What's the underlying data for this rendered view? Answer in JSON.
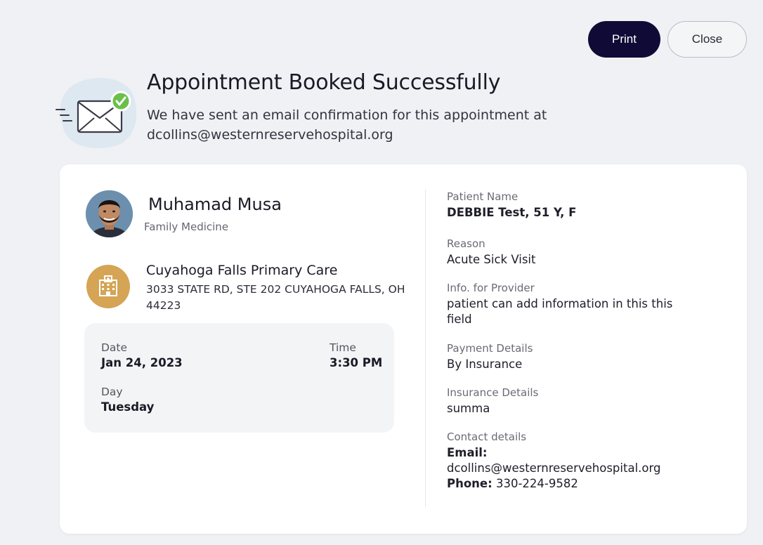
{
  "actions": {
    "print_label": "Print",
    "close_label": "Close"
  },
  "confirmation": {
    "title": "Appointment Booked Successfully",
    "message": "We have sent an email confirmation for this appointment at dcollins@westernreservehospital.org",
    "icon": "email-sent-check-icon"
  },
  "provider": {
    "name": "Muhamad Musa",
    "specialty": "Family Medicine"
  },
  "facility": {
    "name": "Cuyahoga Falls Primary Care",
    "address": "3033 STATE RD, STE 202 CUYAHOGA FALLS, OH 44223",
    "icon": "hospital-building-icon"
  },
  "schedule": {
    "date_label": "Date",
    "date_value": "Jan 24, 2023",
    "time_label": "Time",
    "time_value": "3:30 PM",
    "day_label": "Day",
    "day_value": "Tuesday"
  },
  "details": {
    "patient_name_label": "Patient Name",
    "patient_name_value": "DEBBIE Test, 51 Y, F",
    "reason_label": "Reason",
    "reason_value": "Acute Sick Visit",
    "info_label": "Info. for Provider",
    "info_value": "patient can add information in this this field",
    "payment_label": "Payment Details",
    "payment_value": "By Insurance",
    "insurance_label": "Insurance Details",
    "insurance_value": "summa",
    "contact_label": "Contact details",
    "email_label": "Email:",
    "email_value": "dcollins@westernreservehospital.org",
    "phone_label": "Phone:",
    "phone_value": "330-224-9582"
  },
  "colors": {
    "primary": "#0f0b36",
    "success": "#6cc04a",
    "facility_accent": "#d5a455",
    "background": "#eff1f4"
  }
}
